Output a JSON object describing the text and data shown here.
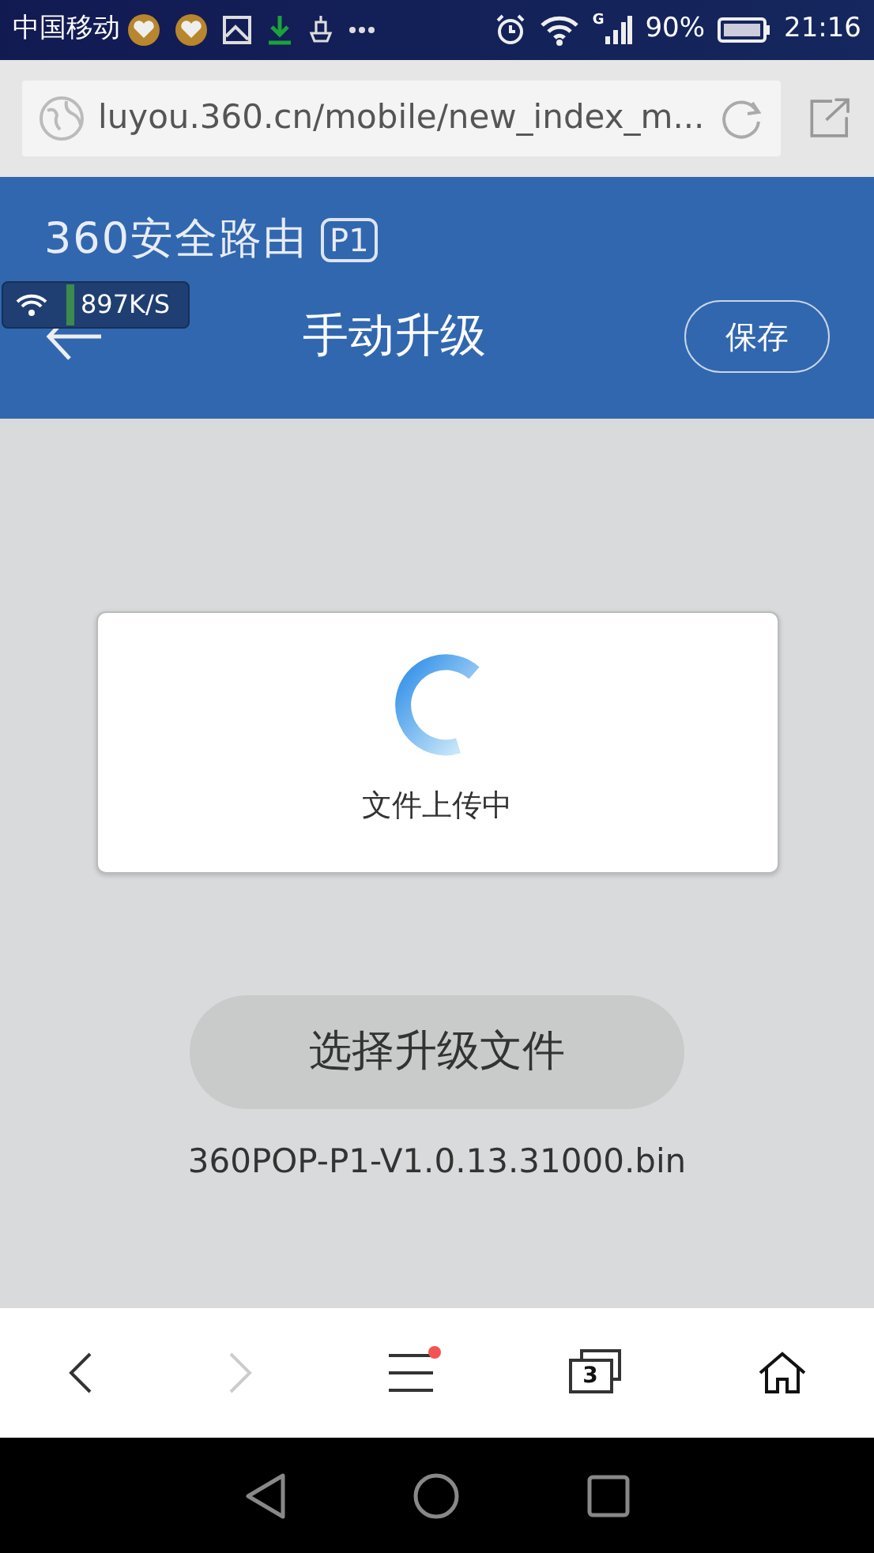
{
  "status_bar": {
    "carrier": "中国移动",
    "network_type": "G",
    "battery": "90%",
    "time": "21:16"
  },
  "browser_bar": {
    "url": "luyou.360.cn/mobile/new_index_m..."
  },
  "header": {
    "logo": "360安全路由",
    "model_badge": "P1",
    "title": "手动升级",
    "save_button": "保存"
  },
  "speed_overlay": {
    "speed": "897K/S"
  },
  "upload_card": {
    "message": "文件上传中"
  },
  "select_file_button": "选择升级文件",
  "file_name": "360POP-P1-V1.0.13.31000.bin",
  "toolbar": {
    "back_disabled": false,
    "forward_disabled": true,
    "menu_notification": true,
    "tab_count": "3"
  }
}
